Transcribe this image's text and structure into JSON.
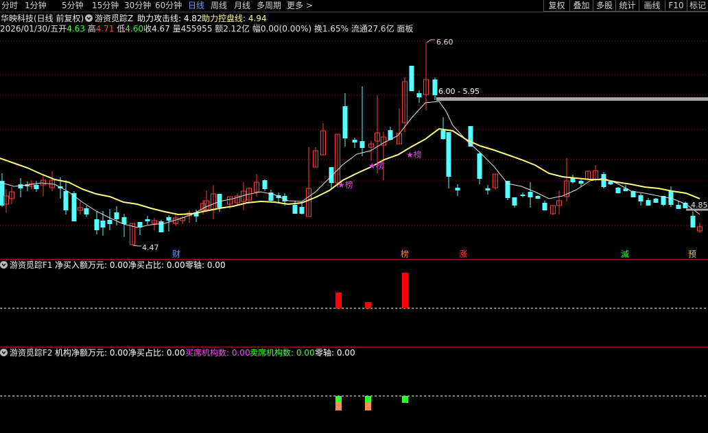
{
  "toolbar": {
    "periods": [
      "分时",
      "1分钟",
      "5分钟",
      "15分钟",
      "30分钟",
      "60分钟",
      "日线",
      "周线",
      "月线",
      "多周期",
      "更多 >"
    ],
    "active_period": "日线",
    "right_buttons": [
      "复权",
      "叠加",
      "多股",
      "统计",
      "画线",
      "F10",
      "标记"
    ]
  },
  "stock": {
    "name": "华映科技(日线 前复权)",
    "indicator_name": "游资觅踪Z",
    "attack_label": "助力攻击线: 4.82",
    "control_label": "助力控盘线: 4.94"
  },
  "quote": {
    "date": "2026/01/30/五",
    "open_label": "开",
    "open": "4.63",
    "high_label": "高",
    "high": "4.71",
    "low_label": "低",
    "low": "4.60",
    "close": "收4.67",
    "volume": "量455955",
    "amount": "额2.12亿",
    "change": "幅0.00(0.00%)",
    "turnover": "换1.65%",
    "float_cap": "流通27.6亿",
    "panel": "面板"
  },
  "chart_annotations": {
    "max_price": "6.60",
    "min_price": "4.47",
    "range_label": "6.00 - 5.95",
    "current_price": "4.85",
    "star_label": "★榜",
    "event_markers": [
      "财",
      "榜",
      "涨",
      "減",
      "预"
    ]
  },
  "panel_f1": {
    "title": "游资觅踪F1",
    "net_buy_label": "净买入额万元: 0.00",
    "net_ratio_label": "净买占比: 0.00",
    "zero_axis_label": "零轴: 0.00"
  },
  "panel_f2": {
    "title": "游资觅踪F2",
    "inst_net_label": "机构净额万元: 0.00",
    "net_ratio_label": "净买占比: 0.00",
    "buy_seats_label": "买席机构数: 0.00",
    "sell_seats_label": "卖席机构数: 0.00",
    "zero_axis_label": "零轴: 0.00"
  },
  "colors": {
    "up": "#ff3c3c",
    "down": "#54ffff",
    "ma_yellow": "#ffff80",
    "ma_white": "#e0e0e0",
    "star": "#e040e0",
    "grid": "#7a1a1a",
    "f1_bar": "#ff0000",
    "f2_green": "#33ff33",
    "f2_orange": "#ff8c50"
  }
}
